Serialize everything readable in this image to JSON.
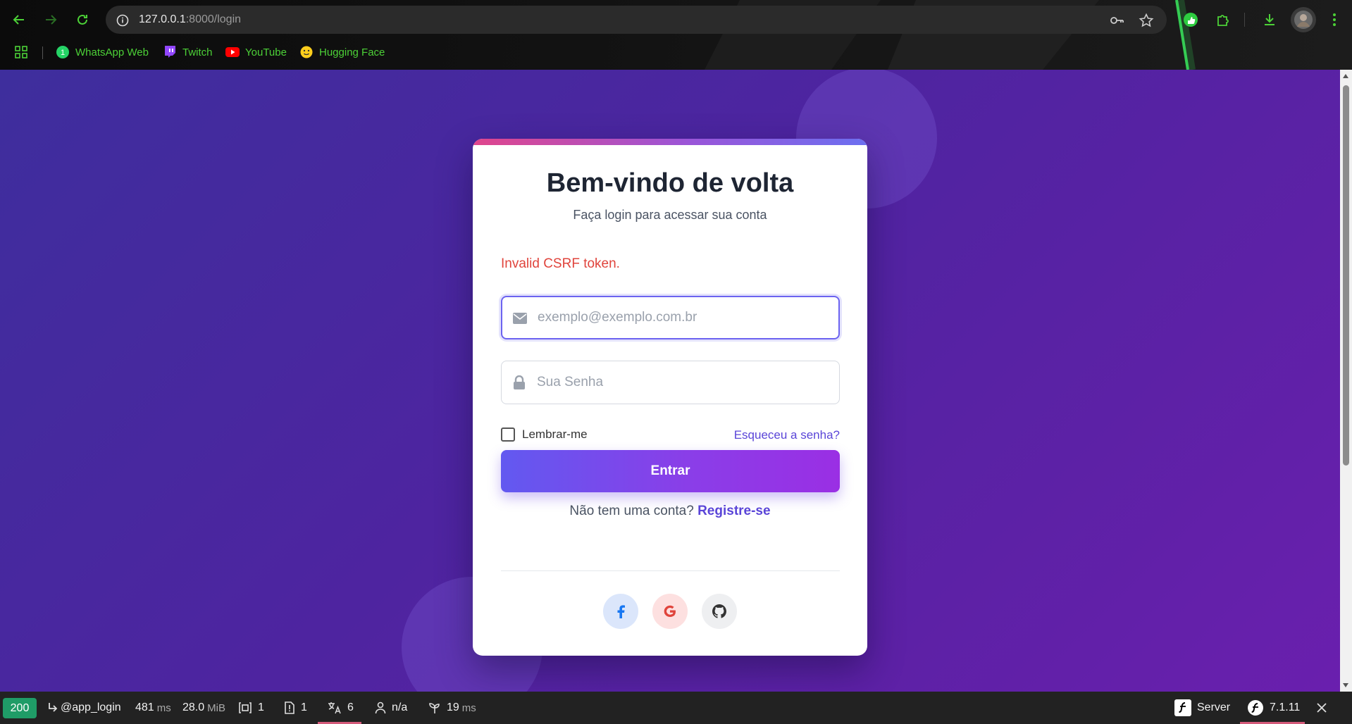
{
  "browser": {
    "url_host": "127.0.0.1",
    "url_path": ":8000/login",
    "bookmarks": [
      {
        "label": "WhatsApp Web",
        "icon": "whatsapp-icon"
      },
      {
        "label": "Twitch",
        "icon": "twitch-icon"
      },
      {
        "label": "YouTube",
        "icon": "youtube-icon"
      },
      {
        "label": "Hugging Face",
        "icon": "hugging-face-icon"
      }
    ],
    "accent": "#4cd137"
  },
  "login": {
    "title": "Bem-vindo de volta",
    "subtitle": "Faça login para acessar sua conta",
    "error": "Invalid CSRF token.",
    "email_placeholder": "exemplo@exemplo.com.br",
    "password_placeholder": "Sua Senha",
    "remember_label": "Lembrar-me",
    "remember_checked": false,
    "forgot_label": "Esqueceu a senha?",
    "submit_label": "Entrar",
    "register_prompt": "Não tem uma conta?",
    "register_link": "Registre-se",
    "social": [
      {
        "name": "facebook",
        "icon": "facebook-icon"
      },
      {
        "name": "google",
        "icon": "google-icon"
      },
      {
        "name": "github",
        "icon": "github-icon"
      }
    ],
    "colors": {
      "primary": "#6259f0",
      "error": "#e0443c",
      "title": "#1e2533"
    }
  },
  "debug_toolbar": {
    "status_code": "200",
    "route": "@app_login",
    "time_value": "481",
    "time_unit": "ms",
    "memory_value": "28.0",
    "memory_unit": "MiB",
    "forms_count": "1",
    "logs_count": "1",
    "translation_count": "6",
    "user": "n/a",
    "twig_value": "19",
    "twig_unit": "ms",
    "server_label": "Server",
    "version": "7.1.11"
  }
}
